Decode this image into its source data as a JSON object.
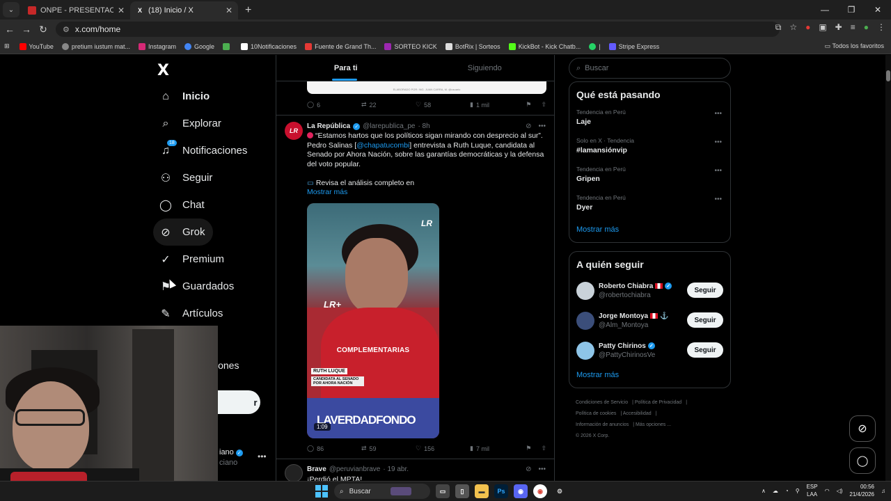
{
  "browser": {
    "tabs": [
      {
        "title": "ONPE - PRESENTACIÓN DE RE",
        "favicon_color": "#d22"
      },
      {
        "title": "(18) Inicio / X",
        "favicon_color": "#fff"
      }
    ],
    "url": "x.com/home",
    "bookmarks": [
      {
        "label": "YouTube",
        "color": "#ff0000"
      },
      {
        "label": "pretium iustum mat...",
        "color": "#888"
      },
      {
        "label": "Instagram",
        "color": "#d62976"
      },
      {
        "label": "Google",
        "color": "#4285f4"
      },
      {
        "label": "",
        "color": "#4caf50"
      },
      {
        "label": "10Notificaciones",
        "color": "#fff"
      },
      {
        "label": "Fuente de Grand Th...",
        "color": "#e53935"
      },
      {
        "label": "SORTEO KICK",
        "color": "#9c27b0"
      },
      {
        "label": "BotRix | Sorteos",
        "color": "#ddd"
      },
      {
        "label": "KickBot - Kick Chatb...",
        "color": "#53fc18"
      },
      {
        "label": "|",
        "color": "#25d366"
      },
      {
        "label": "Stripe Express",
        "color": "#635bff"
      }
    ],
    "bookmarks_right": "Todos los favoritos"
  },
  "sidebar": {
    "logo": "X",
    "items": [
      {
        "label": "Inicio",
        "icon": "home-icon"
      },
      {
        "label": "Explorar",
        "icon": "search-icon"
      },
      {
        "label": "Notificaciones",
        "icon": "bell-icon",
        "badge": "18"
      },
      {
        "label": "Seguir",
        "icon": "person-add-icon"
      },
      {
        "label": "Chat",
        "icon": "chat-icon"
      },
      {
        "label": "Grok",
        "icon": "grok-icon"
      },
      {
        "label": "Premium",
        "icon": "premium-icon"
      },
      {
        "label": "Guardados",
        "icon": "bookmark-icon"
      },
      {
        "label": "Artículos",
        "icon": "article-icon"
      }
    ],
    "partial_more": "iones",
    "post_button_partial": "r",
    "profile_name_partial": "iano",
    "profile_handle_partial": "ciano"
  },
  "timeline": {
    "tabs": [
      {
        "label": "Para ti"
      },
      {
        "label": "Siguiendo"
      }
    ],
    "prev_post_chart_caption": "ELABORADO POR: ING. JUAN CARRA, M. @usuario",
    "prev_actions": {
      "replies": "6",
      "reposts": "22",
      "likes": "58",
      "views": "1 mil"
    },
    "post": {
      "author": "La República",
      "handle": "@larepublica_pe",
      "time": "· 8h",
      "avatar_text": "LR",
      "text_1": "“Estamos hartos que los políticos sigan mirando con desprecio al sur”. Pedro Salinas [",
      "mention": "@chapatucombi",
      "text_2": "] entrevista a Ruth Luque, candidata al Senado por Ahora Nación, sobre las garantías democráticas y la defensa del voto popular.",
      "text_3": "Revisa el análisis completo en",
      "show_more": "Mostrar más",
      "video": {
        "logo": "LR",
        "mic_logo": "LR+",
        "caption": "COMPLEMENTARIAS",
        "name_tag": "RUTH LUQUE",
        "role_tag": "CANDIDATA AL SENADO POR AHORA NACIÓN",
        "show_name": "LAVERDADFONDO",
        "duration": "1:09"
      },
      "actions": {
        "replies": "86",
        "reposts": "59",
        "likes": "156",
        "views": "7 mil"
      }
    },
    "next_post": {
      "author": "Brave",
      "handle": "@peruvianbrave",
      "time": "· 19 abr.",
      "text": "¡Perdió el MPTA!"
    }
  },
  "right": {
    "search_placeholder": "Buscar",
    "trends_title": "Qué está pasando",
    "trends": [
      {
        "meta": "Tendencia en Perú",
        "title": "Laje"
      },
      {
        "meta": "Solo en X · Tendencia",
        "title": "#lamansiónvip"
      },
      {
        "meta": "Tendencia en Perú",
        "title": "Gripen"
      },
      {
        "meta": "Tendencia en Perú",
        "title": "Dyer"
      }
    ],
    "trends_more": "Mostrar más",
    "follow_title": "A quién seguir",
    "follow": [
      {
        "name": "Roberto Chiabra",
        "handle": "@robertochiabra",
        "button": "Seguir",
        "avatar_color": "#c9d2d9"
      },
      {
        "name": "Jorge Montoya",
        "handle": "@Alm_Montoya",
        "button": "Seguir",
        "avatar_color": "#3b4e7a"
      },
      {
        "name": "Patty Chirinos",
        "handle": "@PattyChirinosVe",
        "button": "Seguir",
        "avatar_color": "#8ec5e8"
      }
    ],
    "follow_more": "Mostrar más",
    "footer": [
      "Condiciones de Servicio",
      "Política de Privacidad",
      "Política de cookies",
      "Accesibilidad",
      "Información de anuncios",
      "Más opciones ...",
      "© 2026 X Corp."
    ]
  },
  "taskbar": {
    "search": "Buscar",
    "lang_1": "ESP",
    "lang_2": "LAA",
    "time": "00:56",
    "date": "21/4/2026"
  },
  "colors": {
    "accent": "#1d9bf0",
    "background": "#000000",
    "border": "#2f3336"
  }
}
